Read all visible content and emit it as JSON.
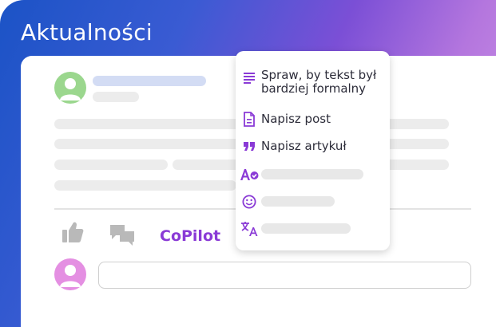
{
  "section": {
    "title": "Aktualności"
  },
  "actions": {
    "like_icon": "thumbs-up-icon",
    "comment_icon": "chat-icon",
    "copilot_label": "CoPilot"
  },
  "comment": {
    "value": "",
    "placeholder": ""
  },
  "menu": {
    "items": [
      {
        "icon": "text-lines-icon",
        "label": "Spraw, by tekst był bardziej formalny"
      },
      {
        "icon": "document-icon",
        "label": "Napisz post"
      },
      {
        "icon": "quote-icon",
        "label": "Napisz artykuł"
      },
      {
        "icon": "spellcheck-icon",
        "label": ""
      },
      {
        "icon": "smiley-icon",
        "label": ""
      },
      {
        "icon": "translate-icon",
        "label": ""
      }
    ]
  },
  "colors": {
    "accent": "#8a3ad6",
    "author_avatar": "#9bd78e",
    "commenter_avatar": "#e48fe2"
  }
}
